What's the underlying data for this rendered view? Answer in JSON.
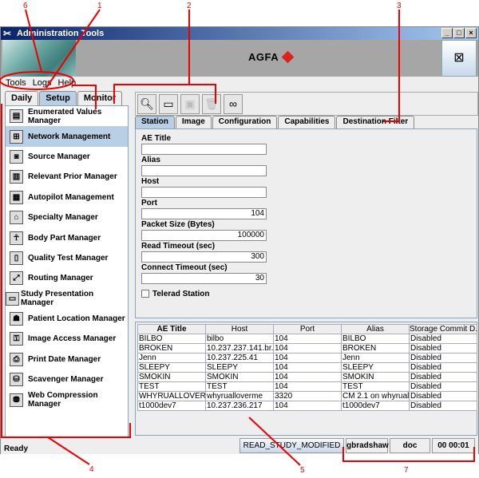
{
  "window": {
    "title": "Administration Tools",
    "brand": "AGFA",
    "controls": [
      "_",
      "□",
      "×"
    ]
  },
  "menu": [
    "Tools",
    "Logs",
    "Help"
  ],
  "left_tabs": [
    "Daily",
    "Setup",
    "Monitor"
  ],
  "left_items": [
    "Enumerated Values Manager",
    "Network Management",
    "Source Manager",
    "Relevant Prior Manager",
    "Autopilot Management",
    "Specialty Manager",
    "Body Part Manager",
    "Quality Test Manager",
    "Routing Manager",
    "Study Presentation Manager",
    "Patient Location Manager",
    "Image Access Manager",
    "Print Date Manager",
    "Scavenger Manager",
    "Web Compression Manager"
  ],
  "right_tabs": [
    "Station",
    "Image",
    "Configuration",
    "Capabilities",
    "Destination Filter"
  ],
  "form": {
    "fields": [
      {
        "label": "AE Title",
        "value": ""
      },
      {
        "label": "Alias",
        "value": ""
      },
      {
        "label": "Host",
        "value": ""
      },
      {
        "label": "Port",
        "value": "104"
      },
      {
        "label": "Packet Size (Bytes)",
        "value": "100000"
      },
      {
        "label": "Read Timeout (sec)",
        "value": "300"
      },
      {
        "label": "Connect Timeout (sec)",
        "value": "30"
      }
    ],
    "checkbox": "Telerad Station"
  },
  "table": {
    "columns": [
      "AE Title",
      "Host",
      "Port",
      "Alias",
      "Storage Commit D..."
    ],
    "rows": [
      [
        "BILBO",
        "bilbo",
        "104",
        "BILBO",
        "Disabled"
      ],
      [
        "BROKEN",
        "10.237.237.141.br...",
        "104",
        "BROKEN",
        "Disabled"
      ],
      [
        "Jenn",
        "10.237.225.41",
        "104",
        "Jenn",
        "Disabled"
      ],
      [
        "SLEEPY",
        "SLEEPY",
        "104",
        "SLEEPY",
        "Disabled"
      ],
      [
        "SMOKIN",
        "SMOKIN",
        "104",
        "SMOKIN",
        "Disabled"
      ],
      [
        "TEST",
        "TEST",
        "104",
        "TEST",
        "Disabled"
      ],
      [
        "WHYRUALLOVER...",
        "whyrualloverme",
        "3320",
        "CM 2.1 on whyrual...",
        "Disabled"
      ],
      [
        "t1000dev7",
        "10.237.236.217",
        "104",
        "t1000dev7",
        "Disabled"
      ]
    ]
  },
  "status": {
    "text": "Ready",
    "event": "READ_STUDY_MODIFIED",
    "user": "gbradshaw",
    "role": "doc",
    "timer": "00 00:01"
  },
  "callouts": [
    "1",
    "2",
    "3",
    "4",
    "5",
    "6",
    "7"
  ],
  "colors": {
    "callout": "#ee0000",
    "selection": "#b8cfe5"
  }
}
